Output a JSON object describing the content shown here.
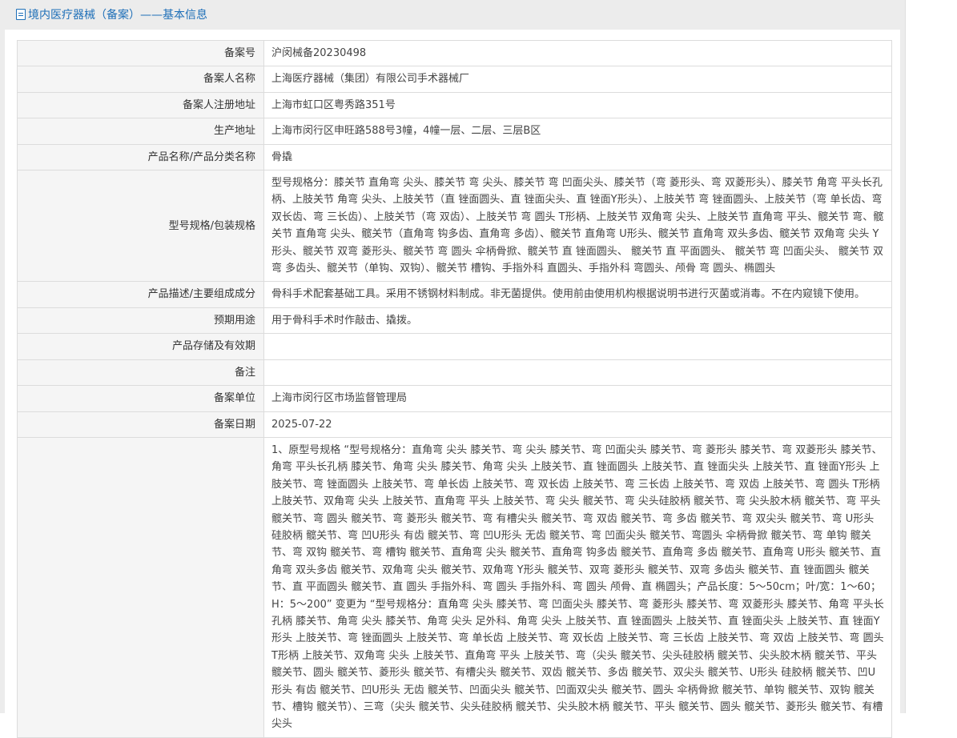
{
  "header": {
    "title": "境内医疗器械（备案）——基本信息",
    "icon": "document-icon"
  },
  "fields": [
    {
      "label": "备案号",
      "value": "沪闵械备20230498"
    },
    {
      "label": "备案人名称",
      "value": "上海医疗器械（集团）有限公司手术器械厂"
    },
    {
      "label": "备案人注册地址",
      "value": "上海市虹口区粤秀路351号"
    },
    {
      "label": "生产地址",
      "value": "上海市闵行区申旺路588号3幢，4幢一层、二层、三层B区"
    },
    {
      "label": "产品名称/产品分类名称",
      "value": "骨撬"
    },
    {
      "label": "型号规格/包装规格",
      "value": "型号规格分：膝关节 直角弯 尖头、膝关节 弯 尖头、膝关节 弯 凹面尖头、膝关节（弯 菱形头、弯 双菱形头）、膝关节 角弯 平头长孔柄、上肢关节 角弯 尖头、上肢关节（直 锉面圆头、直 锉面尖头、直 锉面Y形头）、上肢关节 弯 锉面圆头、上肢关节（弯 单长齿、弯 双长齿、弯 三长齿）、上肢关节（弯 双齿）、上肢关节 弯 圆头 T形柄、上肢关节 双角弯 尖头、上肢关节 直角弯 平头、髋关节 弯、髋关节 直角弯 尖头、髋关节（直角弯 钩多齿、直角弯 多齿）、髋关节 直角弯 U形头、髋关节 直角弯 双头多齿、髋关节 双角弯 尖头 Y形头、髋关节 双弯 菱形头、髋关节 弯 圆头 伞柄骨掀、髋关节 直 锉面圆头、 髋关节 直 平面圆头、 髋关节 弯 凹面尖头、 髋关节 双弯 多齿头、髋关节（单钩、双钩）、髋关节 槽钩、手指外科 直圆头、手指外科 弯圆头、颅骨 弯 圆头、椭圆头"
    },
    {
      "label": "产品描述/主要组成成分",
      "value": "骨科手术配套基础工具。采用不锈钢材料制成。非无菌提供。使用前由使用机构根据说明书进行灭菌或消毒。不在内窥镜下使用。"
    },
    {
      "label": "预期用途",
      "value": "用于骨科手术时作敲击、撬拨。"
    },
    {
      "label": "产品存储及有效期",
      "value": ""
    },
    {
      "label": "备注",
      "value": ""
    },
    {
      "label": "备案单位",
      "value": "上海市闵行区市场监督管理局"
    },
    {
      "label": "备案日期",
      "value": "2025-07-22"
    },
    {
      "label": "",
      "value": "1、原型号规格 “型号规格分：直角弯 尖头 膝关节、弯 尖头 膝关节、弯 凹面尖头 膝关节、弯 菱形头 膝关节、弯 双菱形头 膝关节、角弯 平头长孔柄 膝关节、角弯 尖头 膝关节、角弯 尖头 上肢关节、直 锉面圆头 上肢关节、直 锉面尖头 上肢关节、直 锉面Y形头 上肢关节、弯 锉面圆头 上肢关节、弯 单长齿 上肢关节、弯 双长齿 上肢关节、弯 三长齿 上肢关节、弯 双齿 上肢关节、弯 圆头 T形柄 上肢关节、双角弯 尖头 上肢关节、直角弯 平头 上肢关节、弯 尖头 髋关节、弯 尖头硅胶柄 髋关节、弯 尖头胶木柄 髋关节、弯 平头 髋关节、弯 圆头 髋关节、弯 菱形头 髋关节、弯 有槽尖头 髋关节、弯 双齿 髋关节、弯 多齿 髋关节、弯 双尖头 髋关节、弯 U形头 硅胶柄 髋关节、弯 凹U形头 有齿 髋关节、弯 凹U形头 无齿 髋关节、弯 凹面尖头 髋关节、弯圆头 伞柄骨掀 髋关节、弯 单钩 髋关节、弯 双钩 髋关节、弯 槽钩 髋关节、直角弯 尖头 髋关节、直角弯 钩多齿 髋关节、直角弯 多齿 髋关节、直角弯 U形头 髋关节、直角弯 双头多齿 髋关节、双角弯 尖头 髋关节、双角弯 Y形头 髋关节、双弯 菱形头 髋关节、双弯 多齿头 髋关节、直 锉面圆头 髋关节、直 平面圆头 髋关节、直 圆头 手指外科、弯 圆头 手指外科、弯 圆头 颅骨、直 椭圆头；产品长度：5～50cm；叶/宽：1～60；H：5～200” 变更为 “型号规格分：直角弯 尖头 膝关节、弯 凹面尖头 膝关节、弯 菱形头 膝关节、弯 双菱形头 膝关节、角弯 平头长孔柄 膝关节、角弯 尖头 膝关节、角弯 尖头 足外科、角弯 尖头 上肢关节、直 锉面圆头 上肢关节、直 锉面尖头 上肢关节、直 锉面Y形头 上肢关节、弯 锉面圆头 上肢关节、弯 单长齿 上肢关节、弯 双长齿 上肢关节、弯 三长齿 上肢关节、弯 双齿 上肢关节、弯 圆头 T形柄 上肢关节、双角弯 尖头 上肢关节、直角弯 平头 上肢关节、弯（尖头 髋关节、尖头硅胶柄 髋关节、尖头胶木柄 髋关节、平头 髋关节、圆头 髋关节、菱形头 髋关节、有槽尖头 髋关节、双齿 髋关节、多齿 髋关节、双尖头 髋关节、U形头 硅胶柄 髋关节、凹U形头 有齿 髋关节、凹U形头 无齿 髋关节、凹面尖头 髋关节、凹面双尖头 髋关节、圆头 伞柄骨掀 髋关节、单钩 髋关节、双钩 髋关节、槽钩 髋关节）、三弯（尖头 髋关节、尖头硅胶柄 髋关节、尖头胶木柄 髋关节、平头 髋关节、圆头 髋关节、菱形头 髋关节、有槽尖头"
    }
  ]
}
